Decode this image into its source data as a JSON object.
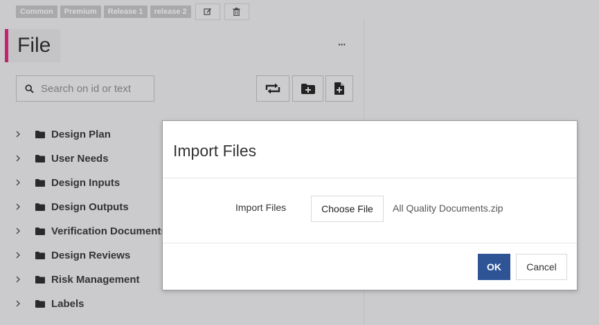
{
  "tags": [
    "Common",
    "Premium",
    "Release 1",
    "release 2"
  ],
  "tag_actions": [
    {
      "icon": "edit-icon"
    },
    {
      "icon": "trash-icon"
    }
  ],
  "header": {
    "title": "File",
    "more_label": "···",
    "accent_color": "#c2256f"
  },
  "search": {
    "placeholder": "Search on id or text",
    "value": ""
  },
  "toolbar": [
    {
      "icon": "sync-icon"
    },
    {
      "icon": "add-folder-icon"
    },
    {
      "icon": "add-file-icon"
    }
  ],
  "tree": {
    "items": [
      {
        "label": "Design Plan"
      },
      {
        "label": "User Needs"
      },
      {
        "label": "Design Inputs"
      },
      {
        "label": "Design Outputs"
      },
      {
        "label": "Verification Documents"
      },
      {
        "label": "Design Reviews"
      },
      {
        "label": "Risk Management"
      },
      {
        "label": "Labels"
      }
    ]
  },
  "modal": {
    "title": "Import Files",
    "field_label": "Import Files",
    "choose_label": "Choose File",
    "file_name": "All Quality Documents.zip",
    "ok_label": "OK",
    "cancel_label": "Cancel",
    "ok_color": "#2e5496"
  }
}
